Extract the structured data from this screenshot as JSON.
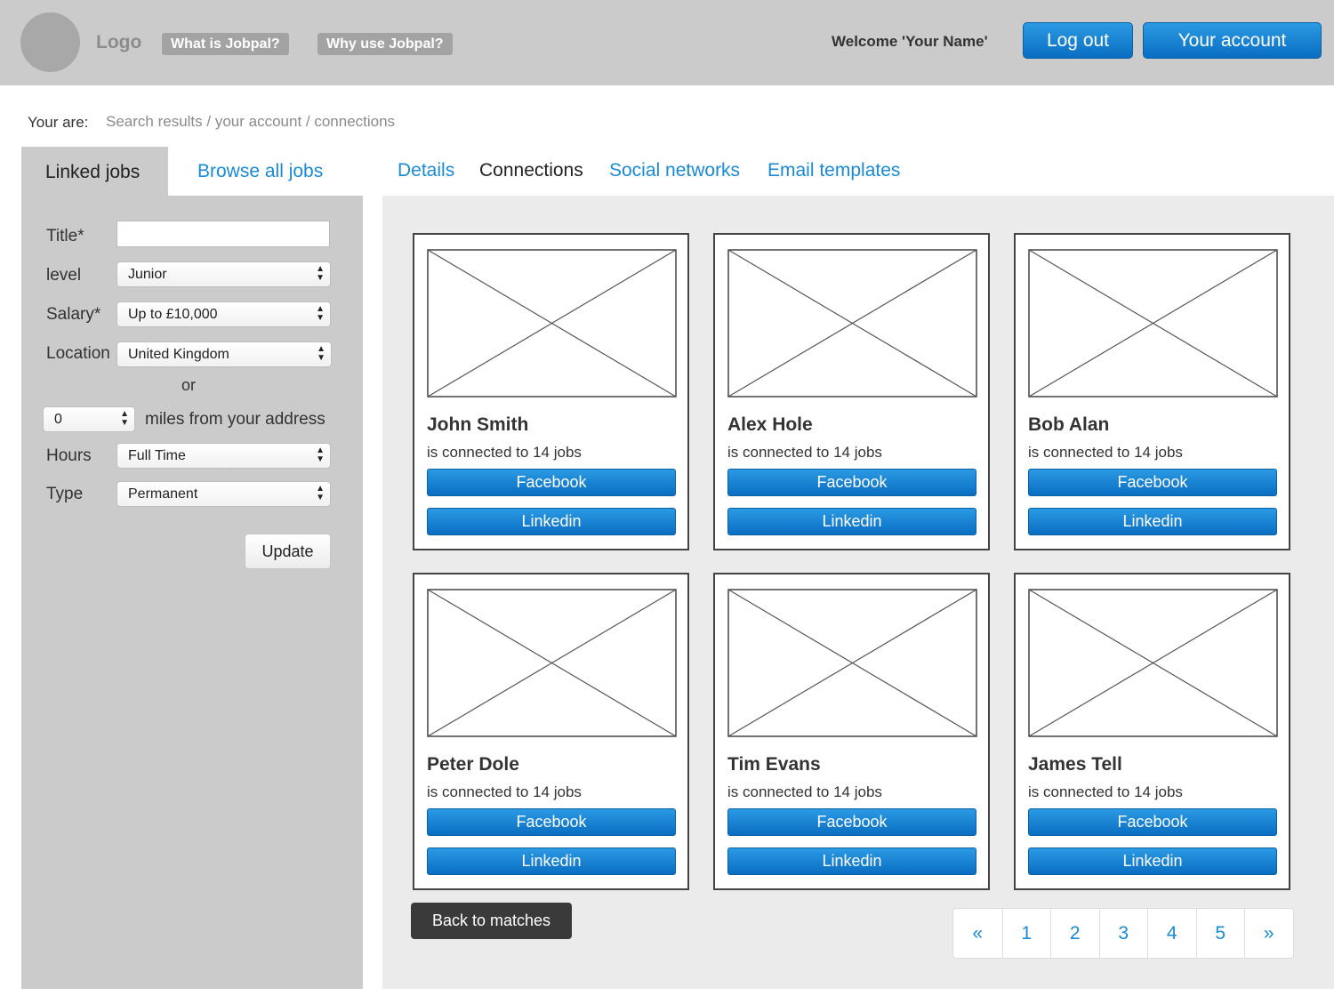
{
  "header": {
    "logo": "Logo",
    "nav": [
      "What is Jobpal?",
      "Why use Jobpal?"
    ],
    "welcome": "Welcome 'Your Name'",
    "logout_label": "Log out",
    "account_label": "Your account"
  },
  "breadcrumb": {
    "label": "Your are:",
    "path": "Search results / your account / connections"
  },
  "left_tabs": {
    "active": "Linked jobs",
    "other": "Browse all jobs"
  },
  "filters": {
    "title_label": "Title*",
    "title_value": "",
    "level_label": "level",
    "level_value": "Junior",
    "salary_label": "Salary*",
    "salary_value": "Up to £10,000",
    "location_label": "Location",
    "location_value": "United Kingdom",
    "or_label": "or",
    "miles_value": "0",
    "miles_label": "miles from your address",
    "hours_label": "Hours",
    "hours_value": "Full Time",
    "type_label": "Type",
    "type_value": "Permanent",
    "update_label": "Update"
  },
  "right_tabs": {
    "details": "Details",
    "connections": "Connections",
    "social": "Social networks",
    "email": "Email templates"
  },
  "connections": [
    {
      "name": "John Smith",
      "subtitle": "is connected to 14 jobs",
      "facebook": "Facebook",
      "linkedin": "Linkedin"
    },
    {
      "name": "Alex Hole",
      "subtitle": "is connected to 14 jobs",
      "facebook": "Facebook",
      "linkedin": "Linkedin"
    },
    {
      "name": "Bob Alan",
      "subtitle": "is connected to 14 jobs",
      "facebook": "Facebook",
      "linkedin": "Linkedin"
    },
    {
      "name": "Peter Dole",
      "subtitle": "is connected to 14 jobs",
      "facebook": "Facebook",
      "linkedin": "Linkedin"
    },
    {
      "name": "Tim Evans",
      "subtitle": "is connected to 14 jobs",
      "facebook": "Facebook",
      "linkedin": "Linkedin"
    },
    {
      "name": "James Tell",
      "subtitle": "is connected to 14 jobs",
      "facebook": "Facebook",
      "linkedin": "Linkedin"
    }
  ],
  "back_label": "Back to matches",
  "pagination": {
    "prev": "«",
    "pages": [
      "1",
      "2",
      "3",
      "4",
      "5"
    ],
    "next": "»"
  },
  "colors": {
    "accent_blue": "#1a8ad6",
    "header_gray": "#cbcbcb",
    "main_bg": "#ebebeb"
  }
}
